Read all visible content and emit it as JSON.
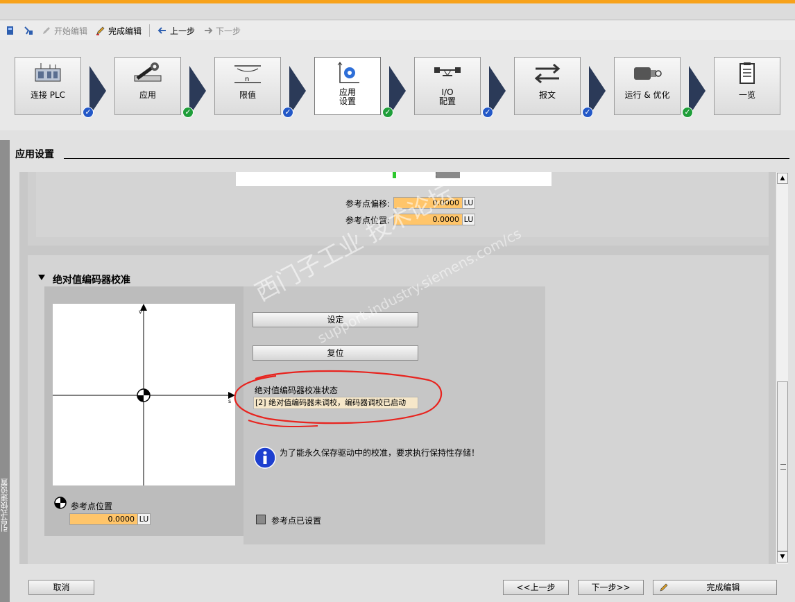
{
  "toolbar": {
    "start_edit": "开始编辑",
    "finish_edit": "完成编辑",
    "prev": "上一步",
    "next": "下一步"
  },
  "wizard": {
    "steps": [
      {
        "label": "连接 PLC",
        "status": "blue"
      },
      {
        "label": "应用",
        "status": "green"
      },
      {
        "label": "限值",
        "label_sub": "n",
        "status": "blue"
      },
      {
        "label_1": "应用",
        "label_2": "设置",
        "status": "green",
        "active": true
      },
      {
        "label_1": "I/O",
        "label_2": "配置",
        "status": "blue"
      },
      {
        "label": "报文",
        "status": "blue"
      },
      {
        "label": "运行 & 优化",
        "status": "green"
      },
      {
        "label": "一览"
      }
    ]
  },
  "side_tab": "引导式快速设置",
  "section_title": "应用设置",
  "ref_offset": {
    "label": "参考点偏移:",
    "value": "0.0000",
    "unit": "LU"
  },
  "ref_position": {
    "label": "参考点位置:",
    "value": "0.0000",
    "unit": "LU"
  },
  "encoder": {
    "title": "绝对值编码器校准",
    "axis_v": "v",
    "axis_s": "s",
    "set_btn": "设定",
    "reset_btn": "复位",
    "status_label": "绝对值编码器校准状态",
    "status_value": "[2] 绝对值编码器未调校，编码器调校已启动",
    "info": "为了能永久保存驱动中的校准，要求执行保持性存储！",
    "ref_point_label": "参考点位置",
    "ref_point_value": "0.0000",
    "ref_point_unit": "LU",
    "ref_set_label": "参考点已设置"
  },
  "bottom": {
    "cancel": "取消",
    "prev": "<<上一步",
    "next": "下一步>>",
    "finish": "完成编辑"
  },
  "watermark": {
    "main": "西门子工业 技术论坛",
    "url": "support.industry.siemens.com/cs"
  },
  "colors": {
    "accent_bar": "#f7a21b",
    "field_bg": "#ffc56a",
    "arrow": "#2b3a58",
    "check_blue": "#2358c7",
    "check_green": "#1f9e3a",
    "annotation": "#e8231e"
  }
}
